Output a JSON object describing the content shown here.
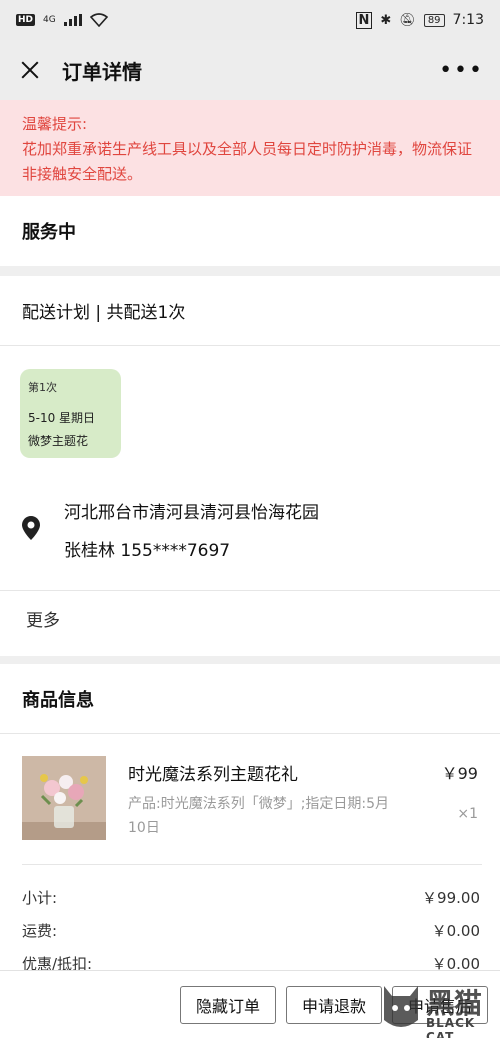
{
  "status_bar": {
    "hd": "HD",
    "network": "4G",
    "battery": "89",
    "time": "7:13"
  },
  "nav": {
    "title": "订单详情"
  },
  "notice": {
    "title": "温馨提示:",
    "body": "花加郑重承诺生产线工具以及全部人员每日定时防护消毒，物流保证非接触安全配送。",
    "text_color": "#e0463f",
    "bg_color": "#fce1e3"
  },
  "order_status": "服务中",
  "delivery_plan": {
    "header": "配送计划 | 共配送1次",
    "chip": {
      "index": "第1次",
      "date": "5-10 星期日",
      "item": "微梦主题花",
      "bg_color": "#d7ebc8"
    },
    "address": "河北邢台市清河县清河县怡海花园",
    "contact": "张桂林 155****7697",
    "more": "更多"
  },
  "goods": {
    "title": "商品信息",
    "product": {
      "name": "时光魔法系列主题花礼",
      "price": "￥99",
      "desc": "产品:时光魔法系列「微梦」;指定日期:5月10日",
      "qty": "×1"
    },
    "totals": [
      {
        "label": "小计:",
        "value": "￥99.00"
      },
      {
        "label": "运费:",
        "value": "￥0.00"
      },
      {
        "label": "优惠/抵扣:",
        "value": "￥0.00"
      }
    ]
  },
  "actions": {
    "hide": "隐藏订单",
    "refund": "申请退款",
    "after_sale": "申请售后"
  },
  "watermark": {
    "cn": "黑猫",
    "en": "BLACK CAT"
  }
}
